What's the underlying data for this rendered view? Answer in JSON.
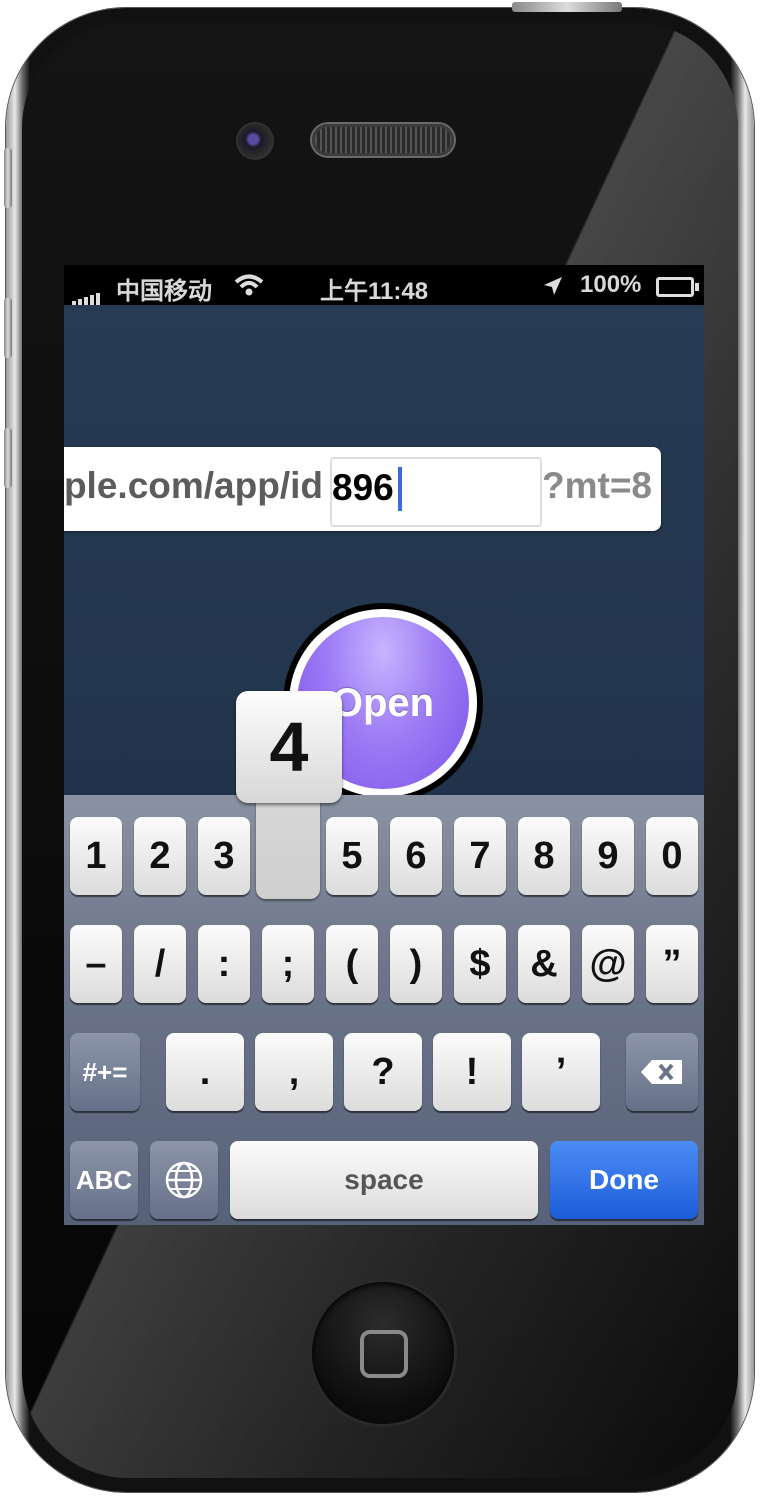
{
  "status_bar": {
    "carrier": "中国移动",
    "time": "上午11:48",
    "battery": "100%"
  },
  "url_bar": {
    "prefix": "ple.com/app/id",
    "app_id": "896",
    "suffix": "?mt=8"
  },
  "open_button": {
    "label": "Open"
  },
  "keyboard": {
    "pressed_key": "4",
    "row1": [
      "1",
      "2",
      "3",
      "4",
      "5",
      "6",
      "7",
      "8",
      "9",
      "0"
    ],
    "row2": [
      "–",
      "/",
      ":",
      ";",
      "(",
      ")",
      "$",
      "&",
      "@",
      "”"
    ],
    "row3": {
      "mode": "#+=",
      "keys": [
        ".",
        ",",
        "?",
        "!",
        "’"
      ]
    },
    "row4": {
      "abc": "ABC",
      "space": "space",
      "done": "Done"
    }
  },
  "colors": {
    "app_background": "#22354d",
    "open_button": "#8b66f0",
    "done_button": "#2a6ae0",
    "cursor": "#3a6cd8"
  }
}
